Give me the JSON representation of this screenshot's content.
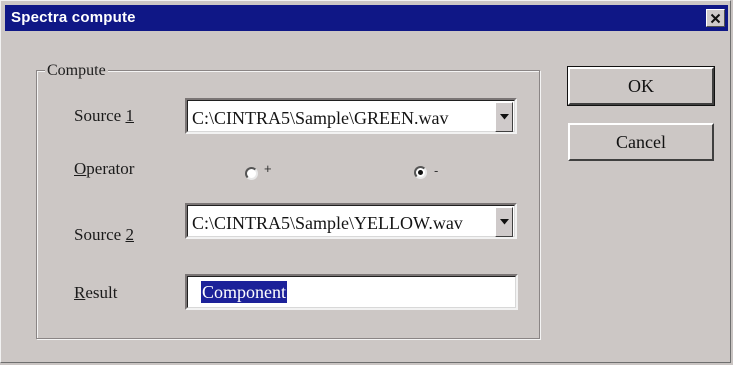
{
  "window": {
    "title": "Spectra compute"
  },
  "compute_group": {
    "legend": "Compute",
    "source1": {
      "label_prefix": "Source ",
      "label_mnemonic": "1",
      "value": "C:\\CINTRA5\\Sample\\GREEN.wav"
    },
    "operator": {
      "label_mnemonic": "O",
      "label_rest": "perator",
      "options": [
        {
          "symbol": "+",
          "selected": false
        },
        {
          "symbol": "-",
          "selected": true
        }
      ]
    },
    "source2": {
      "label_prefix": "Source ",
      "label_mnemonic": "2",
      "value": "C:\\CINTRA5\\Sample\\YELLOW.wav"
    },
    "result": {
      "label_mnemonic": "R",
      "label_rest": "esult",
      "value": "Component"
    }
  },
  "buttons": {
    "ok_label": "OK",
    "cancel_label": "Cancel"
  },
  "colors": {
    "titlebar": "#0f1786",
    "dialog_face": "#ccc7c5",
    "selection": "#1c2199"
  },
  "icons": {
    "close": "close-icon",
    "dropdown": "dropdown-arrow-icon"
  }
}
